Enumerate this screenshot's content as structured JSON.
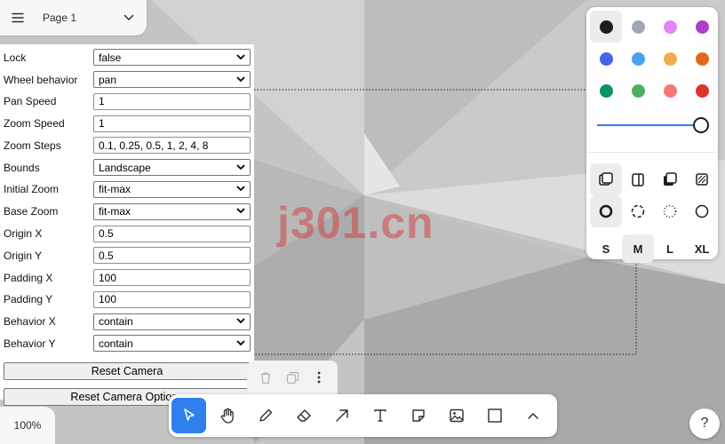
{
  "page_menu": {
    "page_name": "Page 1",
    "menu_icon": "hamburger-icon",
    "expand_icon": "chevron-down-icon"
  },
  "camera_options": {
    "rows": [
      {
        "label": "Lock",
        "value": "false",
        "kind": "select"
      },
      {
        "label": "Wheel behavior",
        "value": "pan",
        "kind": "select"
      },
      {
        "label": "Pan Speed",
        "value": "1",
        "kind": "input"
      },
      {
        "label": "Zoom Speed",
        "value": "1",
        "kind": "input"
      },
      {
        "label": "Zoom Steps",
        "value": "0.1, 0.25, 0.5, 1, 2, 4, 8",
        "kind": "input"
      },
      {
        "label": "Bounds",
        "value": "Landscape",
        "kind": "select"
      },
      {
        "label": "Initial Zoom",
        "value": "fit-max",
        "kind": "select"
      },
      {
        "label": "Base Zoom",
        "value": "fit-max",
        "kind": "select"
      },
      {
        "label": "Origin X",
        "value": "0.5",
        "kind": "input"
      },
      {
        "label": "Origin Y",
        "value": "0.5",
        "kind": "input"
      },
      {
        "label": "Padding X",
        "value": "100",
        "kind": "input"
      },
      {
        "label": "Padding Y",
        "value": "100",
        "kind": "input"
      },
      {
        "label": "Behavior X",
        "value": "contain",
        "kind": "select"
      },
      {
        "label": "Behavior Y",
        "value": "contain",
        "kind": "select"
      }
    ],
    "reset_camera_label": "Reset Camera",
    "reset_options_label": "Reset Camera Options"
  },
  "style_panel": {
    "colors": [
      {
        "name": "black",
        "hex": "#1d1d1d",
        "selected": true
      },
      {
        "name": "grey",
        "hex": "#9fa8b2",
        "selected": false
      },
      {
        "name": "light-violet",
        "hex": "#e085f4",
        "selected": false
      },
      {
        "name": "violet",
        "hex": "#ae3ec9",
        "selected": false
      },
      {
        "name": "blue",
        "hex": "#4465e9",
        "selected": false
      },
      {
        "name": "light-blue",
        "hex": "#4ba1f1",
        "selected": false
      },
      {
        "name": "yellow",
        "hex": "#f1ac4b",
        "selected": false
      },
      {
        "name": "orange",
        "hex": "#e16919",
        "selected": false
      },
      {
        "name": "green",
        "hex": "#099268",
        "selected": false
      },
      {
        "name": "light-green",
        "hex": "#4cb05e",
        "selected": false
      },
      {
        "name": "light-red",
        "hex": "#f87777",
        "selected": false
      },
      {
        "name": "red",
        "hex": "#e03131",
        "selected": false
      }
    ],
    "opacity_fraction": 1.0,
    "fill_icons": [
      "fill-none-icon",
      "fill-semi-icon",
      "fill-solid-icon",
      "fill-pattern-icon"
    ],
    "dash_icons": [
      "dash-draw-icon",
      "dash-dashed-icon",
      "dash-dotted-icon",
      "dash-solid-icon"
    ],
    "sizes": [
      "S",
      "M",
      "L",
      "XL"
    ],
    "selected_size": "M"
  },
  "action_bar": {
    "icons": [
      "trash-icon",
      "duplicate-icon",
      "more-icon"
    ]
  },
  "toolbar": {
    "tools": [
      "select-icon",
      "hand-icon",
      "draw-icon",
      "eraser-icon",
      "arrow-icon",
      "text-icon",
      "note-icon",
      "image-icon",
      "rectangle-icon",
      "chevron-up-icon"
    ],
    "active_tool": "select-icon",
    "accent": "#2f80ed"
  },
  "zoom": {
    "label": "100%"
  },
  "help": {
    "label": "?"
  },
  "watermark": {
    "text": "j301.cn"
  }
}
